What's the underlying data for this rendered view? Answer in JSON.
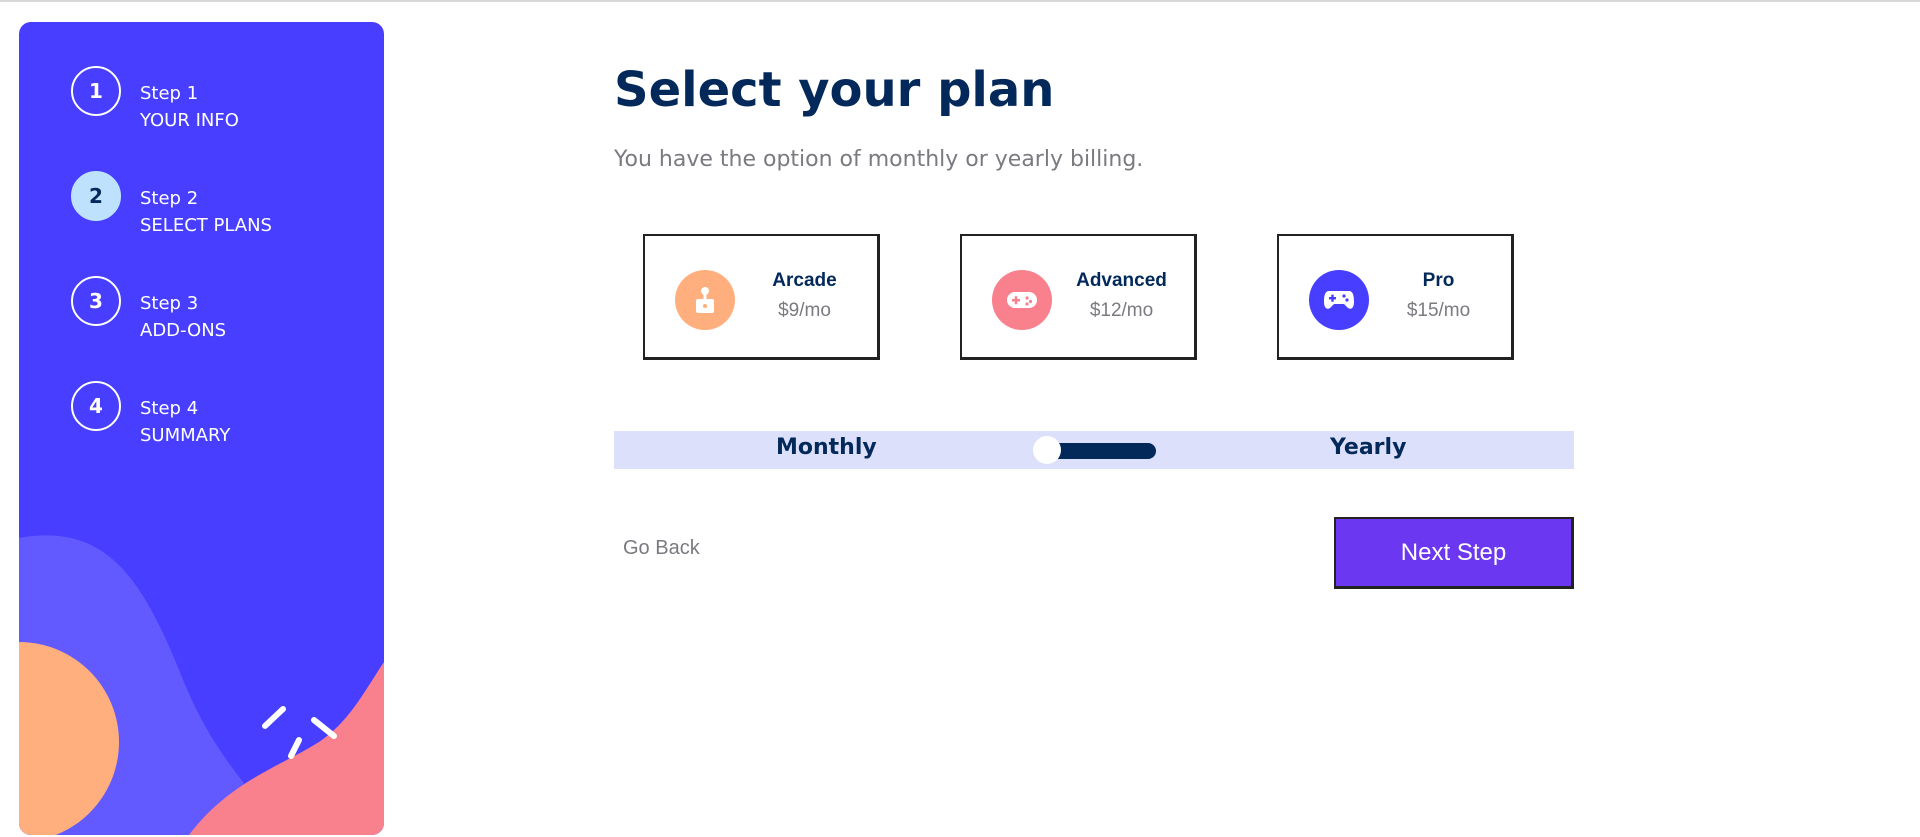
{
  "colors": {
    "sidebar_bg": "#483eff",
    "active_step": "#bee2fd",
    "title": "#02295a",
    "muted": "#7a7a80",
    "arcade_icon": "#ffaf7e",
    "advanced_icon": "#f9818e",
    "pro_icon": "#483eff",
    "toggle_bg": "#dce0fb",
    "next_button": "#6b37f0"
  },
  "sidebar": {
    "steps": [
      {
        "number": "1",
        "label": "Step 1",
        "name": "YOUR INFO",
        "active": false
      },
      {
        "number": "2",
        "label": "Step 2",
        "name": "SELECT PLANS",
        "active": true
      },
      {
        "number": "3",
        "label": "Step 3",
        "name": "ADD-ONS",
        "active": false
      },
      {
        "number": "4",
        "label": "Step 4",
        "name": "SUMMARY",
        "active": false
      }
    ]
  },
  "main": {
    "title": "Select your plan",
    "subtitle": "You have the option of monthly or yearly billing.",
    "plans": [
      {
        "name": "Arcade",
        "price": "$9/mo",
        "icon": "joystick-icon"
      },
      {
        "name": "Advanced",
        "price": "$12/mo",
        "icon": "gamepad-icon"
      },
      {
        "name": "Pro",
        "price": "$15/mo",
        "icon": "controller-icon"
      }
    ],
    "billing": {
      "monthly_label": "Monthly",
      "yearly_label": "Yearly",
      "selected": "Monthly"
    },
    "go_back_label": "Go Back",
    "next_step_label": "Next Step"
  }
}
